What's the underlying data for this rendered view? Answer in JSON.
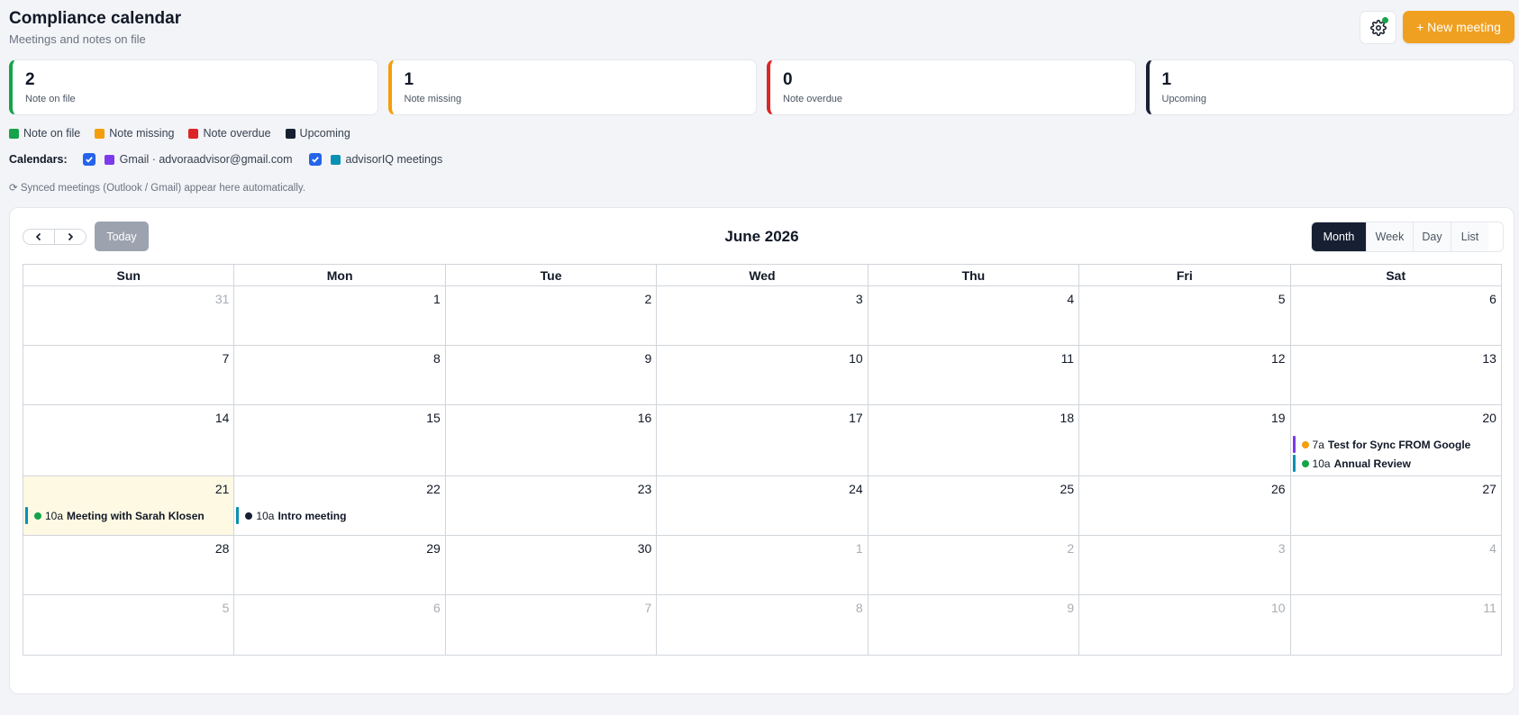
{
  "header": {
    "title": "Compliance calendar",
    "subtitle": "Meetings and notes on file"
  },
  "actions": {
    "settings_icon": "gear-icon",
    "new_meeting_label": "+ New meeting"
  },
  "stats": [
    {
      "value": "2",
      "label": "Note on file",
      "color": "#16a34a"
    },
    {
      "value": "1",
      "label": "Note missing",
      "color": "#f59e0b"
    },
    {
      "value": "0",
      "label": "Note overdue",
      "color": "#dc2626"
    },
    {
      "value": "1",
      "label": "Upcoming",
      "color": "#172033"
    }
  ],
  "legend": [
    {
      "label": "Note on file",
      "color": "#16a34a"
    },
    {
      "label": "Note missing",
      "color": "#f59e0b"
    },
    {
      "label": "Note overdue",
      "color": "#dc2626"
    },
    {
      "label": "Upcoming",
      "color": "#172033"
    }
  ],
  "calendars": {
    "label": "Calendars:",
    "items": [
      {
        "label": "Gmail · advoraadvisor@gmail.com",
        "color": "#7c3aed",
        "checked": true
      },
      {
        "label": "advisorIQ meetings",
        "color": "#0891b2",
        "checked": true
      }
    ]
  },
  "sync_note": "⟳ Synced meetings (Outlook / Gmail) appear here automatically.",
  "toolbar": {
    "prev_icon": "chevron-left-icon",
    "next_icon": "chevron-right-icon",
    "today_label": "Today",
    "month_title": "June 2026",
    "views": [
      {
        "label": "Month",
        "active": true
      },
      {
        "label": "Week",
        "active": false
      },
      {
        "label": "Day",
        "active": false
      },
      {
        "label": "List",
        "active": false
      }
    ]
  },
  "weekdays": [
    "Sun",
    "Mon",
    "Tue",
    "Wed",
    "Thu",
    "Fri",
    "Sat"
  ],
  "weeks": [
    [
      {
        "d": "31",
        "other": true
      },
      {
        "d": "1"
      },
      {
        "d": "2"
      },
      {
        "d": "3"
      },
      {
        "d": "4"
      },
      {
        "d": "5"
      },
      {
        "d": "6"
      }
    ],
    [
      {
        "d": "7"
      },
      {
        "d": "8"
      },
      {
        "d": "9"
      },
      {
        "d": "10"
      },
      {
        "d": "11"
      },
      {
        "d": "12"
      },
      {
        "d": "13"
      }
    ],
    [
      {
        "d": "14"
      },
      {
        "d": "15"
      },
      {
        "d": "16"
      },
      {
        "d": "17"
      },
      {
        "d": "18"
      },
      {
        "d": "19"
      },
      {
        "d": "20",
        "events": [
          {
            "time": "7a",
            "title": "Test for Sync FROM Google",
            "bar": "#7c3aed",
            "dot": "#f59e0b"
          },
          {
            "time": "10a",
            "title": "Annual Review",
            "bar": "#0891b2",
            "dot": "#16a34a"
          }
        ]
      }
    ],
    [
      {
        "d": "21",
        "today": true,
        "events": [
          {
            "time": "10a",
            "title": "Meeting with Sarah Klosen",
            "bar": "#0891b2",
            "dot": "#16a34a"
          }
        ]
      },
      {
        "d": "22",
        "events": [
          {
            "time": "10a",
            "title": "Intro meeting",
            "bar": "#0891b2",
            "dot": "#172033"
          }
        ]
      },
      {
        "d": "23"
      },
      {
        "d": "24"
      },
      {
        "d": "25"
      },
      {
        "d": "26"
      },
      {
        "d": "27"
      }
    ],
    [
      {
        "d": "28"
      },
      {
        "d": "29"
      },
      {
        "d": "30"
      },
      {
        "d": "1",
        "other": true
      },
      {
        "d": "2",
        "other": true
      },
      {
        "d": "3",
        "other": true
      },
      {
        "d": "4",
        "other": true
      }
    ],
    [
      {
        "d": "5",
        "other": true
      },
      {
        "d": "6",
        "other": true
      },
      {
        "d": "7",
        "other": true
      },
      {
        "d": "8",
        "other": true
      },
      {
        "d": "9",
        "other": true
      },
      {
        "d": "10",
        "other": true
      },
      {
        "d": "11",
        "other": true
      }
    ]
  ]
}
